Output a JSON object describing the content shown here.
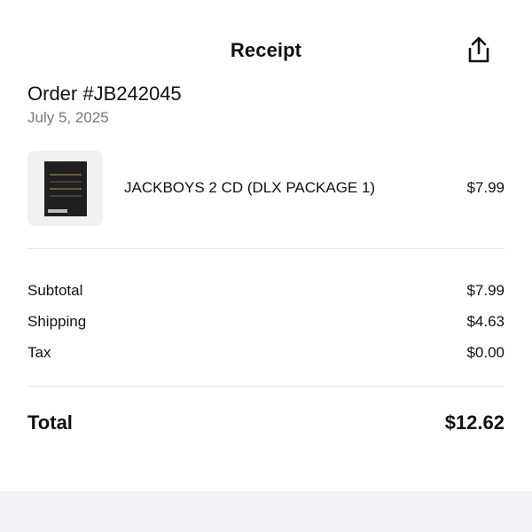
{
  "header": {
    "title": "Receipt",
    "share_icon": "share-icon"
  },
  "order": {
    "number": "Order #JB242045",
    "date": "July 5, 2025"
  },
  "items": [
    {
      "name": "JACKBOYS 2 CD (DLX PACKAGE 1)",
      "price": "$7.99",
      "thumbnail": "album-cover"
    }
  ],
  "summary": {
    "subtotal_label": "Subtotal",
    "subtotal_value": "$7.99",
    "shipping_label": "Shipping",
    "shipping_value": "$4.63",
    "tax_label": "Tax",
    "tax_value": "$0.00",
    "total_label": "Total",
    "total_value": "$12.62"
  },
  "colors": {
    "text": "#111111",
    "muted": "#777777",
    "divider": "#e6e6e6",
    "thumb_bg": "#f1f1f1",
    "bottom_bar": "#f2f2f4"
  }
}
